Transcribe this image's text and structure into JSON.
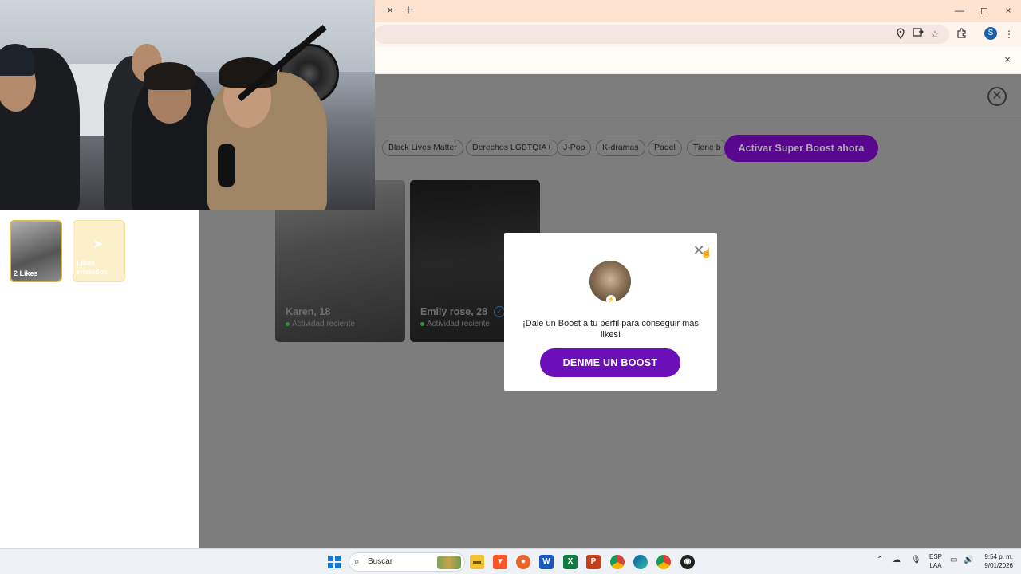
{
  "browser": {
    "tab_close": "×",
    "new_tab": "+",
    "window_controls": {
      "minimize": "—",
      "maximize": "◻",
      "close": "×"
    },
    "toolbar_icons": [
      "location-icon",
      "install-icon",
      "star-icon",
      "extensions-icon"
    ],
    "profile_initial": "S",
    "menu_glyph": "⋮",
    "infobar_close": "×"
  },
  "page": {
    "close_glyph": "✕",
    "interest_chips": [
      "Black Lives Matter",
      "Derechos LGBTQIA+",
      "J-Pop",
      "K-dramas",
      "Padel",
      "Tiene b"
    ],
    "boost_cta": "Activar Super Boost ahora",
    "sidebar_thumbs": [
      {
        "label": "2 Likes"
      },
      {
        "label": "Likes enviados"
      }
    ],
    "cards": [
      {
        "name": "Karen, 18",
        "activity": "Actividad reciente",
        "verified": false
      },
      {
        "name": "Emily rose, 28",
        "activity": "Actividad reciente",
        "verified": true
      }
    ]
  },
  "modal": {
    "close_glyph": "✕",
    "message": "¡Dale un Boost a tu perfil para conseguir más likes!",
    "button": "DENME UN BOOST",
    "accent": "#6d0fb8"
  },
  "taskbar": {
    "search_placeholder": "Buscar",
    "apps": [
      "file-explorer-icon",
      "brave-icon",
      "firefox-icon",
      "word-icon",
      "excel-icon",
      "powerpoint-icon",
      "chrome-icon",
      "edge-icon",
      "chrome-profile-icon",
      "obs-icon"
    ],
    "tray_lang_1": "ESP",
    "tray_lang_2": "LAA",
    "time": "9:54 p. m.",
    "date": "9/01/2026"
  }
}
